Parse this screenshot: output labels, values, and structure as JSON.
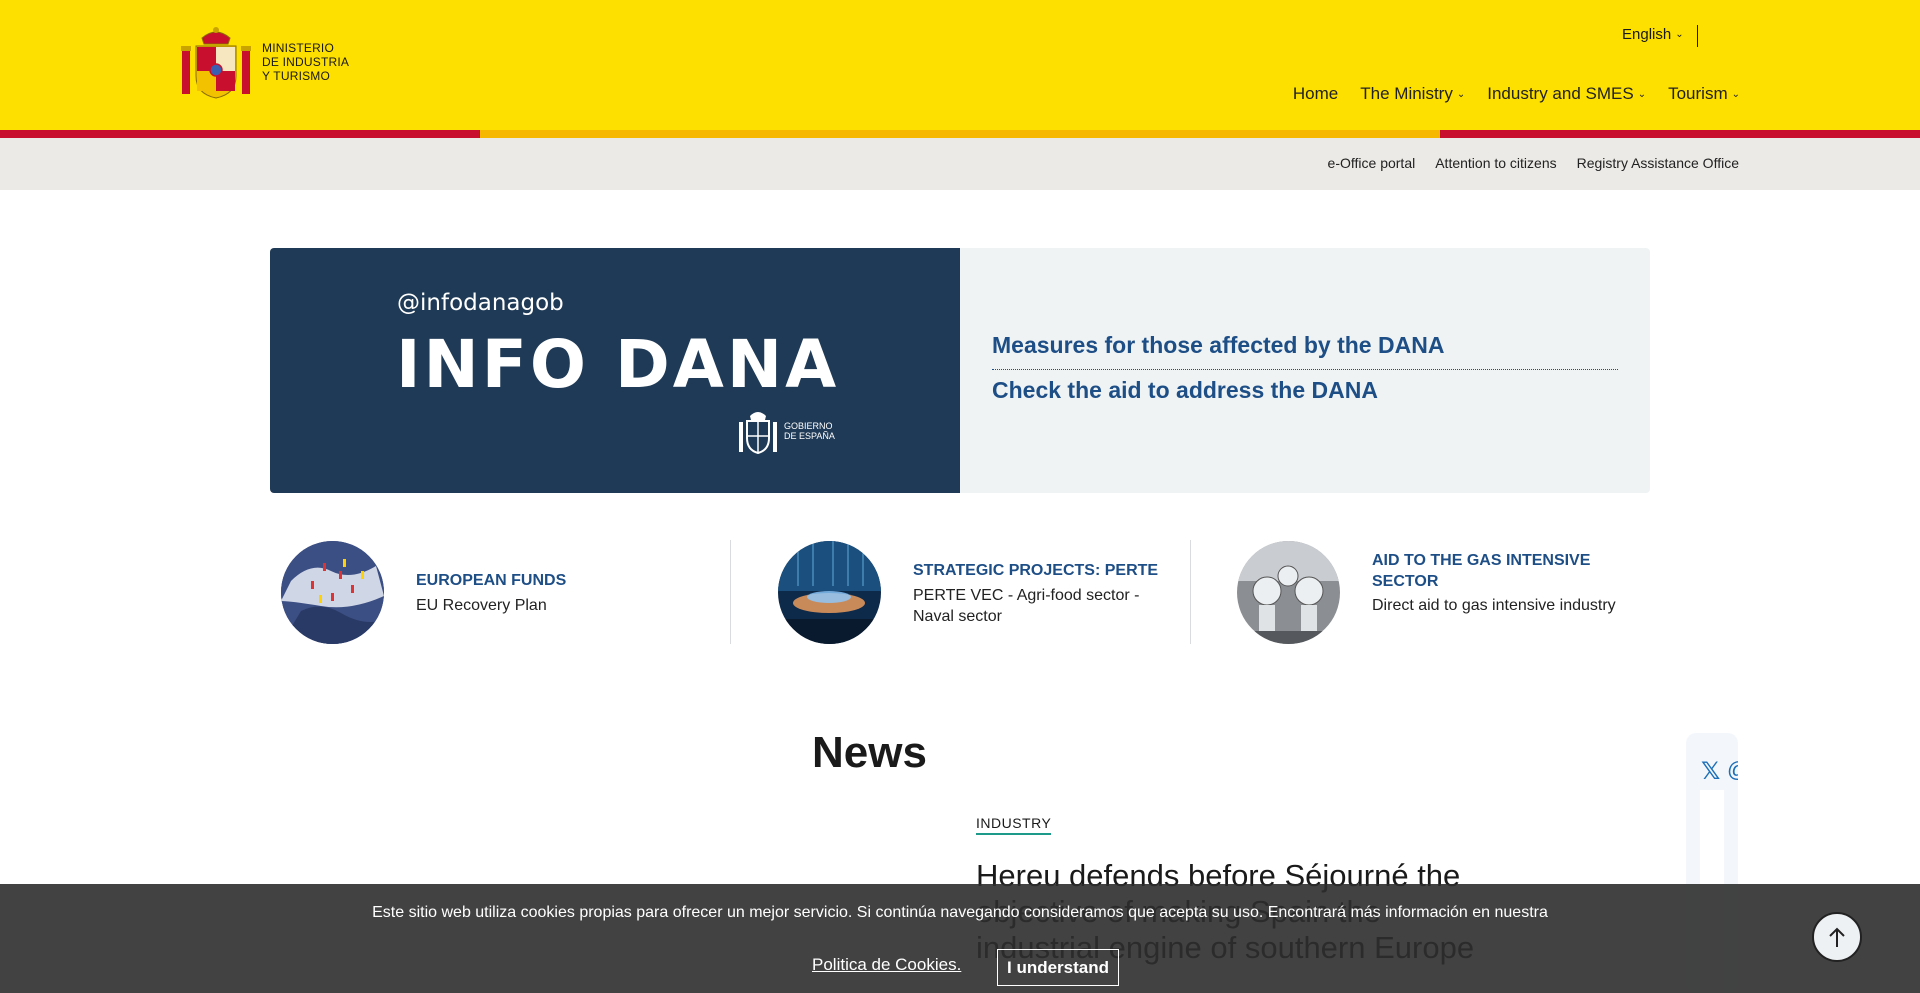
{
  "header": {
    "logo_lines": [
      "MINISTERIO",
      "DE INDUSTRIA",
      "Y TURISMO"
    ],
    "language": "English",
    "nav": [
      {
        "label": "Home",
        "has_submenu": false
      },
      {
        "label": "The Ministry",
        "has_submenu": true
      },
      {
        "label": "Industry and SMES",
        "has_submenu": true
      },
      {
        "label": "Tourism",
        "has_submenu": true
      }
    ],
    "sub_nav": [
      "e-Office portal",
      "Attention to citizens",
      "Registry Assistance Office"
    ]
  },
  "banner": {
    "handle": "@infodanagob",
    "title": "INFO DANA",
    "gob_lines": [
      "GOBIERNO",
      "DE ESPAÑA"
    ],
    "links": [
      "Measures for those affected by the DANA",
      "Check the aid to address the DANA"
    ]
  },
  "cards": [
    {
      "title": "EUROPEAN FUNDS",
      "description": "EU Recovery Plan"
    },
    {
      "title": "STRATEGIC PROJECTS: PERTE",
      "description": "PERTE VEC - Agri-food sector - Naval sector"
    },
    {
      "title": "AID TO THE GAS INTENSIVE SECTOR",
      "description": "Direct aid to gas intensive industry"
    }
  ],
  "news": {
    "section_title": "News",
    "tag": "INDUSTRY",
    "headline": "Hereu defends before Séjourné the objective of making Spain the industrial engine of southern Europe"
  },
  "cookie": {
    "text": "Este sitio web utiliza cookies propias para ofrecer un mejor servicio. Si continúa navegando consideramos que acepta su uso. Encontrará más información en nuestra",
    "link": "Politica de Cookies.",
    "button": "I understand"
  },
  "colors": {
    "header_yellow": "#fddf00",
    "stripe_red": "#c8102e",
    "banner_navy": "#1f3a56",
    "link_blue": "#1e4e86"
  },
  "icons": [
    "spain-coat-of-arms-icon",
    "chevron-down-icon",
    "x-twitter-icon",
    "arrow-up-icon"
  ]
}
